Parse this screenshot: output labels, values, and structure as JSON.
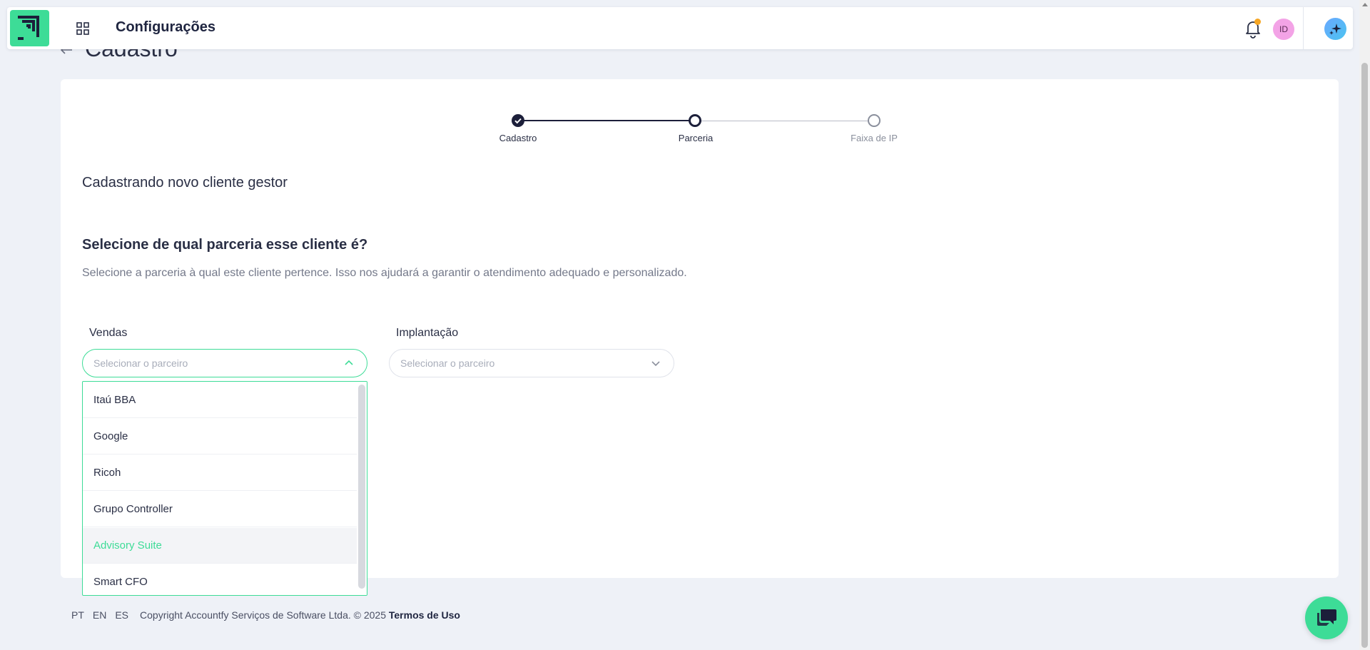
{
  "topbar": {
    "title": "Configurações",
    "avatar_initials": "ID",
    "icons": [
      "logo",
      "apps-grid-icon",
      "bell-icon",
      "sparkles-icon"
    ],
    "accent_color": "#3ddc97",
    "notification_dot_color": "#f6a623"
  },
  "page": {
    "title": "Cadastro"
  },
  "stepper": {
    "steps": [
      {
        "label": "Cadastro",
        "state": "completed"
      },
      {
        "label": "Parceria",
        "state": "active"
      },
      {
        "label": "Faixa de IP",
        "state": "pending"
      }
    ],
    "active_color": "#1c1f3a",
    "pending_color": "#8a8f9c"
  },
  "form": {
    "subtitle": "Cadastrando novo cliente gestor",
    "question": "Selecione de qual parceria esse cliente é?",
    "description": "Selecione a parceria à qual este cliente pertence. Isso nos ajudará a garantir o atendimento adequado e personalizado.",
    "vendas": {
      "label": "Vendas",
      "placeholder": "Selecionar o parceiro",
      "open": true,
      "options": [
        "Itaú BBA",
        "Google",
        "Ricoh",
        "Grupo Controller",
        "Advisory Suite",
        "Smart CFO"
      ],
      "highlighted": "Advisory Suite"
    },
    "implantacao": {
      "label": "Implantação",
      "placeholder": "Selecionar o parceiro",
      "open": false
    }
  },
  "footer": {
    "languages": [
      "PT",
      "EN",
      "ES"
    ],
    "copyright": "Copyright Accountfy Serviços de Software Ltda. © 2025",
    "terms": "Termos de Uso"
  }
}
